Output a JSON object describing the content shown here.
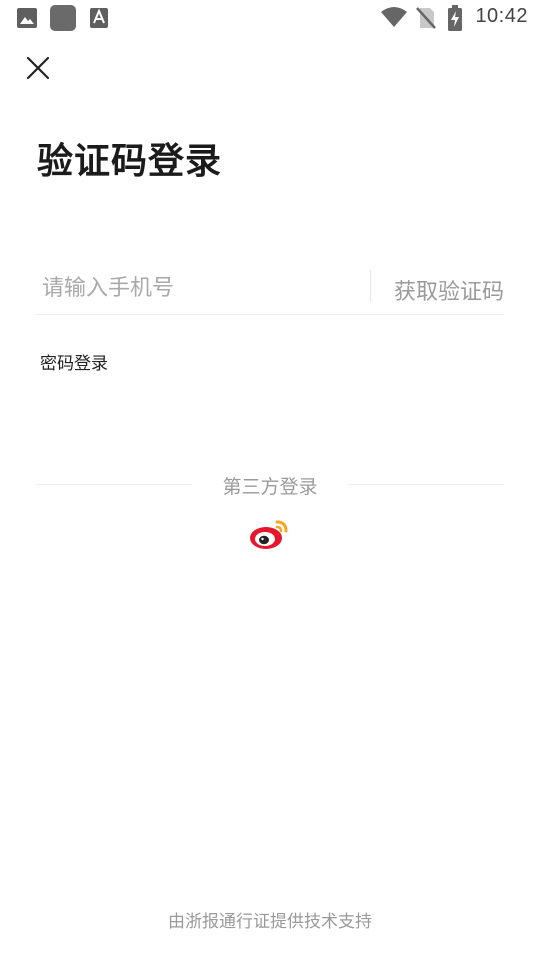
{
  "status_bar": {
    "time": "10:42",
    "left_icons": [
      "image-icon",
      "app-square-icon",
      "text-a-icon"
    ],
    "right_icons": [
      "wifi-icon",
      "no-sim-icon",
      "battery-charging-icon"
    ]
  },
  "header": {
    "close_icon": "close-icon"
  },
  "title": "验证码登录",
  "phone": {
    "value": "",
    "placeholder": "请输入手机号",
    "get_code_label": "获取验证码"
  },
  "password_login_label": "密码登录",
  "third_party": {
    "label": "第三方登录",
    "providers": [
      "weibo-icon"
    ]
  },
  "footer": "由浙报通行证提供技术支持",
  "colors": {
    "text_primary": "#1b1b1b",
    "text_muted": "#9a9a9a",
    "divider": "#ececec",
    "weibo_red": "#e6162d",
    "weibo_orange": "#f5a623"
  }
}
